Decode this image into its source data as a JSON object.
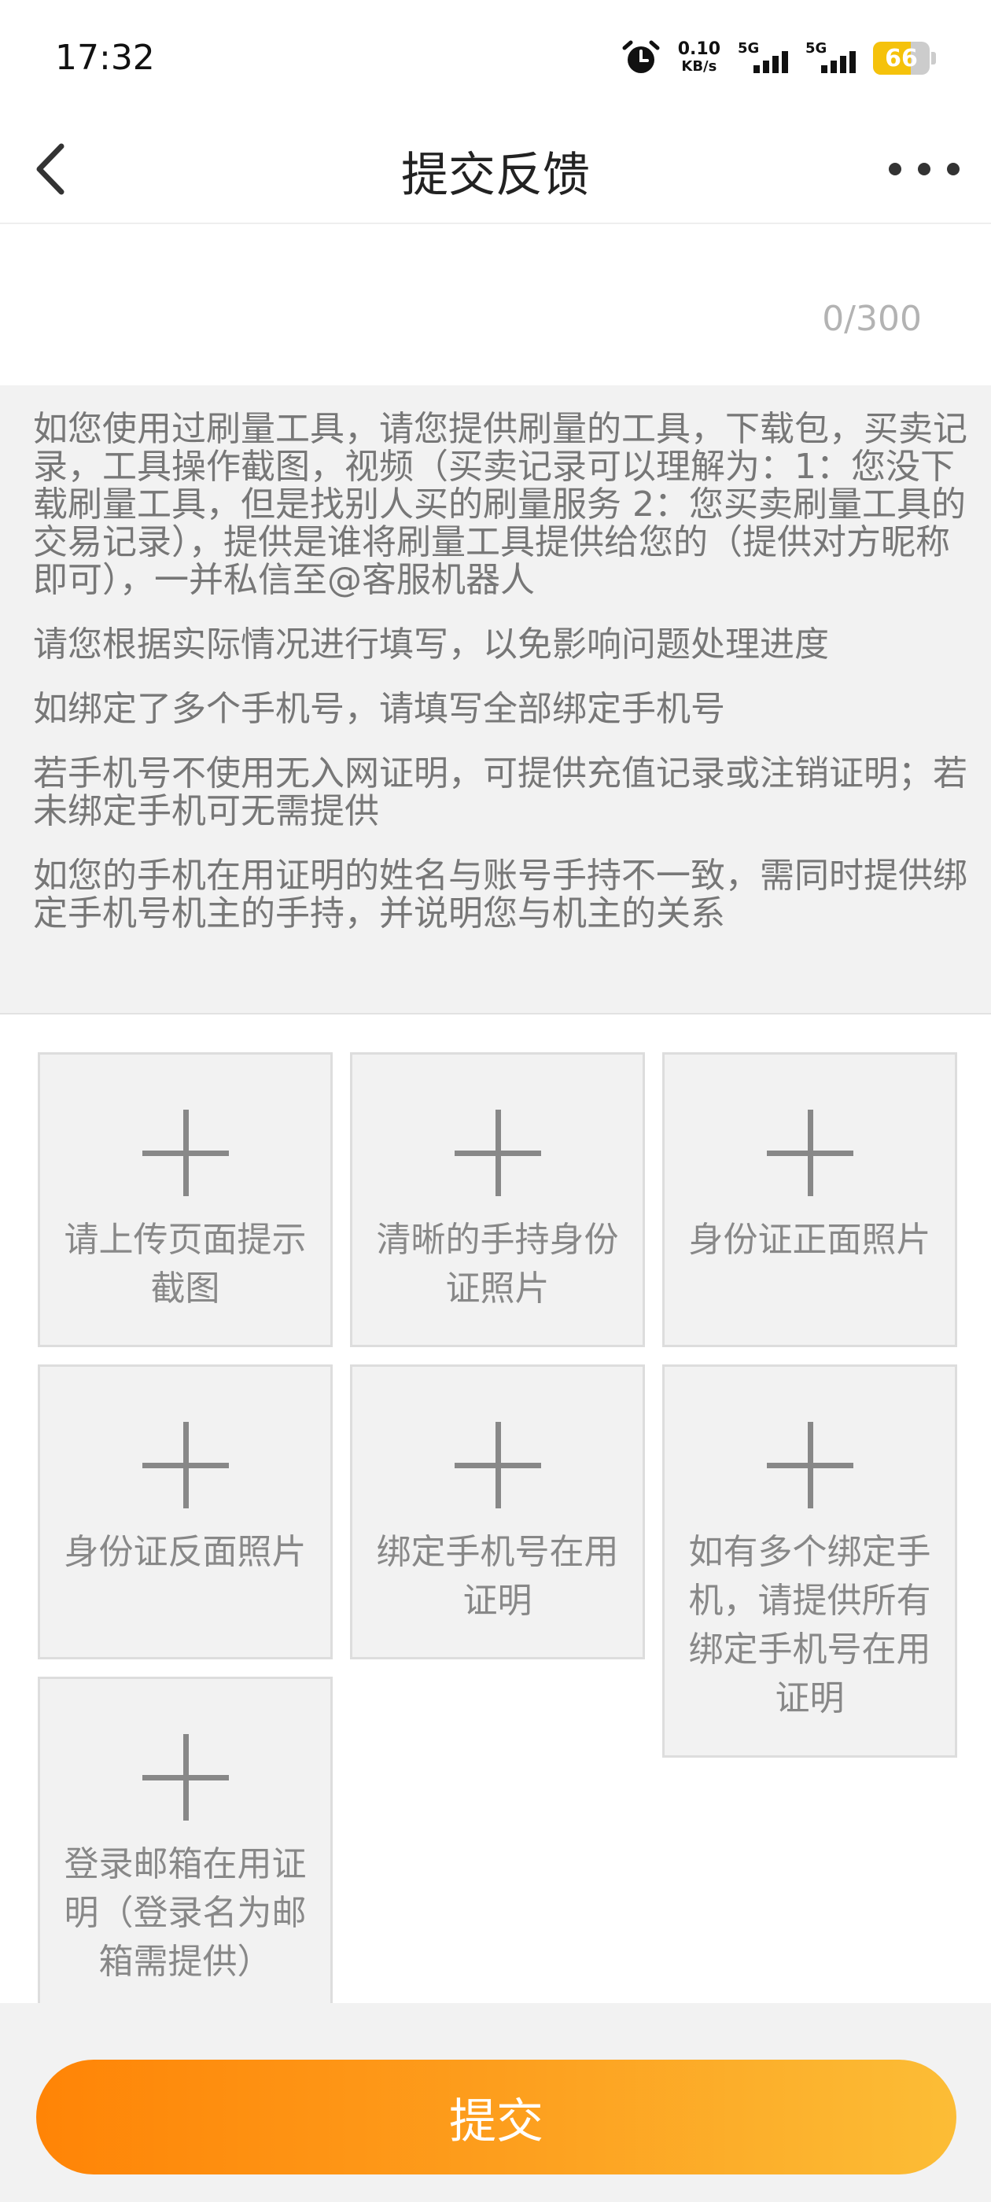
{
  "status_bar": {
    "time": "17:32",
    "net_speed_value": "0.10",
    "net_speed_unit": "KB/s",
    "sim1_label": "5G",
    "sim2_label": "5G",
    "battery_level": "66",
    "icons": [
      "alarm-icon",
      "signal-icon",
      "battery-icon"
    ]
  },
  "header": {
    "title": "提交反馈",
    "back_icon": "chevron-left-icon",
    "more_icon": "more-dots-icon"
  },
  "feedback_input": {
    "value": "",
    "placeholder": "",
    "counter": "0/300"
  },
  "notice": {
    "paragraphs": [
      "如您使用过刷量工具，请您提供刷量的工具，下载包，买卖记录，工具操作截图，视频（买卖记录可以理解为：1：您没下载刷量工具，但是找别人买的刷量服务 2：您买卖刷量工具的交易记录），提供是谁将刷量工具提供给您的（提供对方昵称即可），一并私信至@客服机器人",
      "请您根据实际情况进行填写，以免影响问题处理进度",
      "如绑定了多个手机号，请填写全部绑定手机号",
      "若手机号不使用无入网证明，可提供充值记录或注销证明；若未绑定手机可无需提供",
      "如您的手机在用证明的姓名与账号手持不一致，需同时提供绑定手机号机主的手持，并说明您与机主的关系"
    ]
  },
  "uploads": [
    {
      "label": "请上传页面提示截图"
    },
    {
      "label": "清晰的手持身份证照片"
    },
    {
      "label": "身份证正面照片"
    },
    {
      "label": "身份证反面照片"
    },
    {
      "label": "绑定手机号在用证明"
    },
    {
      "label": "如有多个绑定手机，请提供所有绑定手机号在用证明"
    },
    {
      "label": "登录邮箱在用证明（登录名为邮箱需提供）"
    }
  ],
  "submit": {
    "label": "提交",
    "gradient_start": "#ff8406",
    "gradient_end": "#fcbd36"
  }
}
